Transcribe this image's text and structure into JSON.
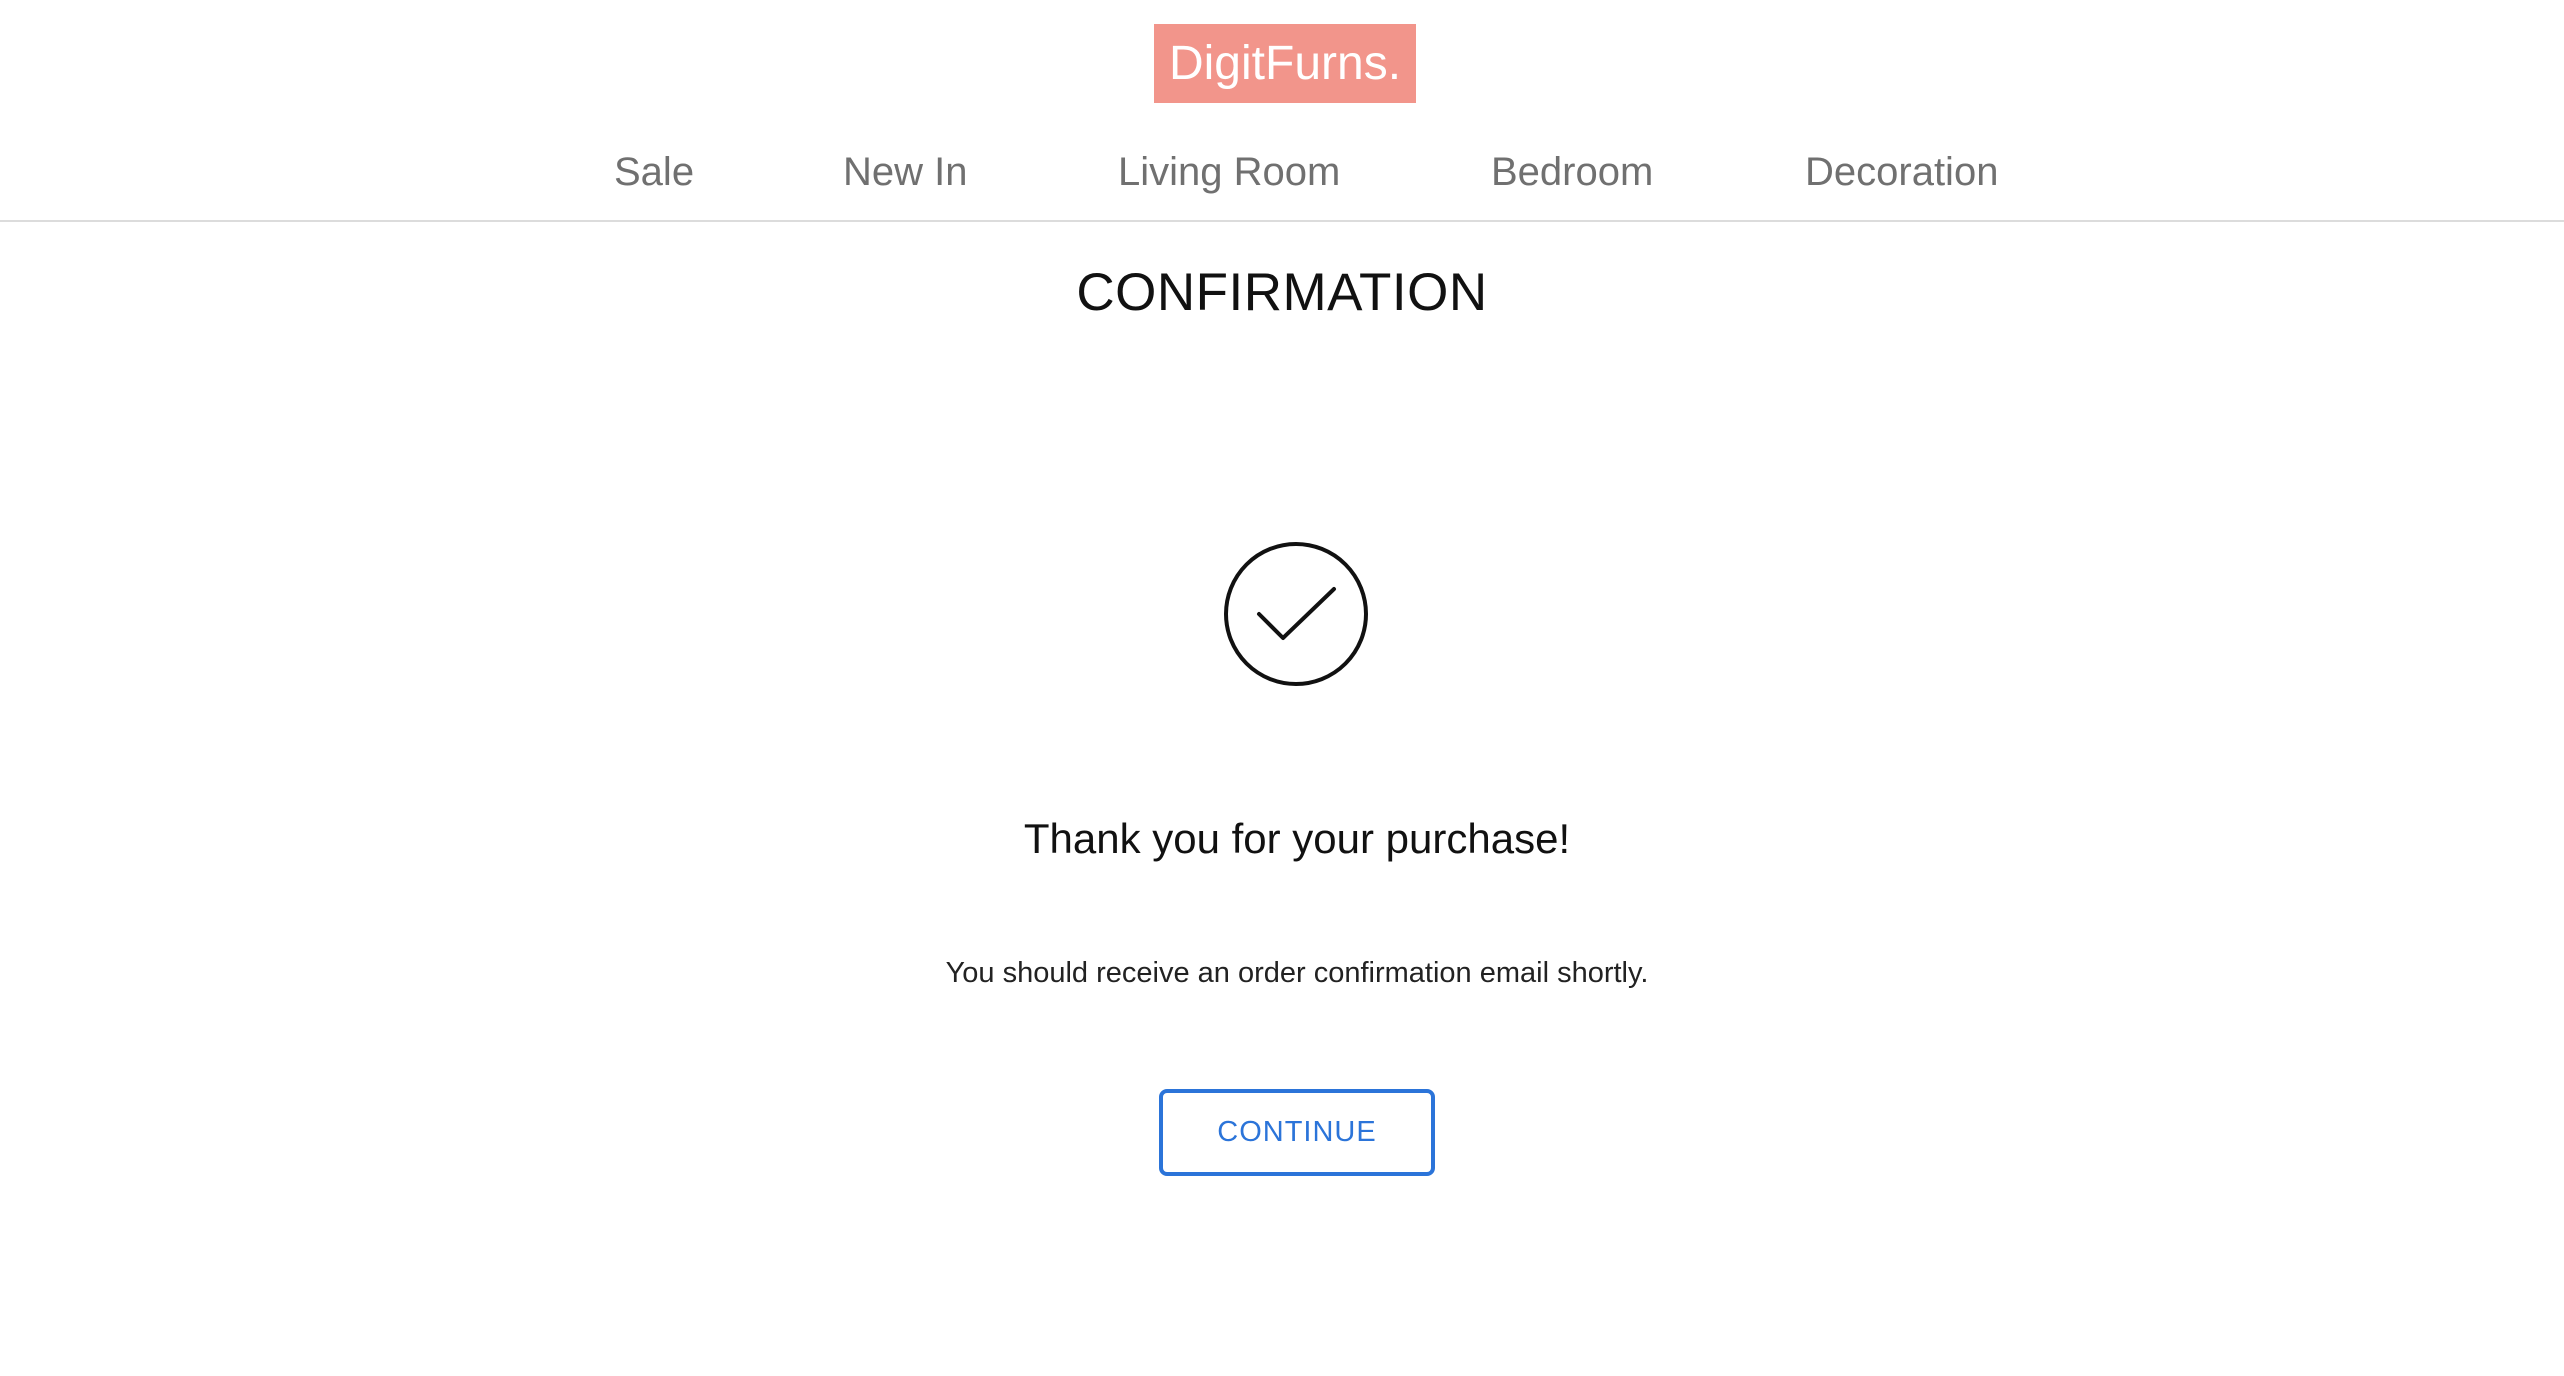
{
  "header": {
    "logo_text": "DigitFurns.",
    "logo_color": "#f2958b"
  },
  "nav": {
    "items": [
      {
        "label": "Sale"
      },
      {
        "label": "New In"
      },
      {
        "label": "Living Room"
      },
      {
        "label": "Bedroom"
      },
      {
        "label": "Decoration"
      }
    ]
  },
  "main": {
    "title": "CONFIRMATION",
    "icon": "check-circle-icon",
    "thank_you": "Thank you for your purchase!",
    "message": "You should receive an order confirmation email shortly.",
    "continue_label": "CONTINUE",
    "accent_color": "#2b74d9"
  }
}
